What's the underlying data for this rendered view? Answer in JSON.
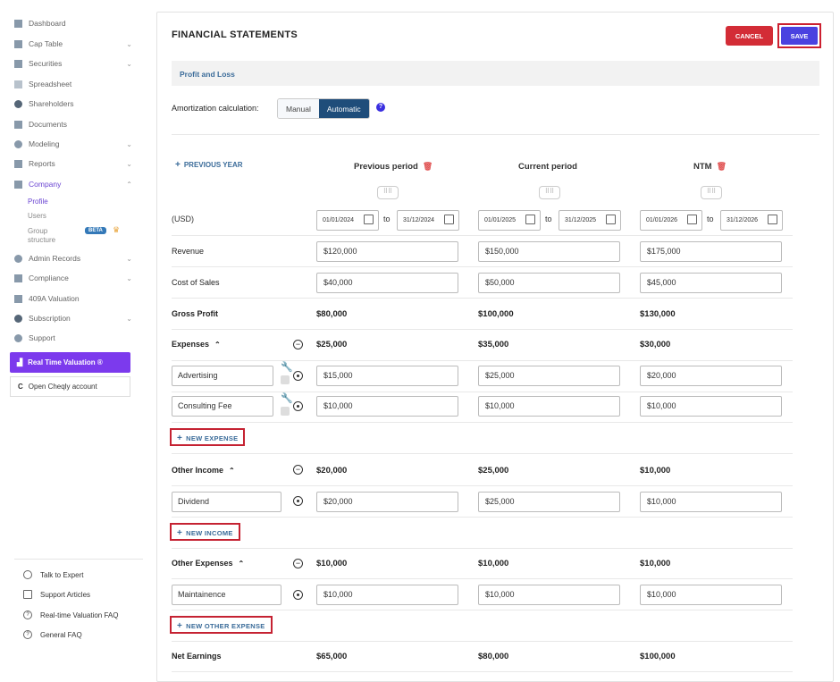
{
  "sidebar": {
    "items": [
      {
        "label": "Dashboard",
        "icon": "dashboard-icon"
      },
      {
        "label": "Cap Table",
        "icon": "cap-table-icon"
      },
      {
        "label": "Securities",
        "icon": "securities-icon"
      },
      {
        "label": "Spreadsheet",
        "icon": "spreadsheet-icon"
      },
      {
        "label": "Shareholders",
        "icon": "shareholders-icon"
      },
      {
        "label": "Documents",
        "icon": "documents-icon"
      },
      {
        "label": "Modeling",
        "icon": "modeling-icon"
      },
      {
        "label": "Reports",
        "icon": "reports-icon"
      },
      {
        "label": "Company",
        "icon": "company-icon"
      },
      {
        "label": "Admin Records",
        "icon": "admin-records-icon"
      },
      {
        "label": "Compliance",
        "icon": "compliance-icon"
      },
      {
        "label": "409A Valuation",
        "icon": "valuation-icon"
      },
      {
        "label": "Subscription",
        "icon": "subscription-icon"
      },
      {
        "label": "Support",
        "icon": "support-icon"
      }
    ],
    "company_sub": [
      "Profile",
      "Users",
      "Group",
      "structure"
    ],
    "beta_badge": "BETA",
    "rtv_label": "Real Time Valuation ®",
    "cheqly_label": "Open Cheqly account",
    "bottom": [
      "Talk to Expert",
      "Support Articles",
      "Real-time Valuation FAQ",
      "General FAQ"
    ]
  },
  "main": {
    "title": "FINANCIAL STATEMENTS",
    "cancel": "CANCEL",
    "save": "SAVE",
    "section": "Profit and Loss",
    "amort_label": "Amortization calculation:",
    "toggle_manual": "Manual",
    "toggle_auto": "Automatic",
    "prev_year": "PREVIOUS YEAR",
    "columns": [
      "Previous period",
      "Current period",
      "NTM"
    ],
    "usd": "(USD)",
    "to": "to",
    "dates": [
      [
        "01/01/2024",
        "31/12/2024"
      ],
      [
        "01/01/2025",
        "31/12/2025"
      ],
      [
        "01/01/2026",
        "31/12/2026"
      ]
    ],
    "revenue": {
      "label": "Revenue",
      "values": [
        "$120,000",
        "$150,000",
        "$175,000"
      ]
    },
    "cos": {
      "label": "Cost of Sales",
      "values": [
        "$40,000",
        "$50,000",
        "$45,000"
      ]
    },
    "gross": {
      "label": "Gross Profit",
      "values": [
        "$80,000",
        "$100,000",
        "$130,000"
      ]
    },
    "expenses": {
      "label": "Expenses",
      "values": [
        "$25,000",
        "$35,000",
        "$30,000"
      ]
    },
    "advertising": {
      "label": "Advertising",
      "values": [
        "$15,000",
        "$25,000",
        "$20,000"
      ]
    },
    "consulting": {
      "label": "Consulting Fee",
      "values": [
        "$10,000",
        "$10,000",
        "$10,000"
      ]
    },
    "new_expense": "NEW EXPENSE",
    "other_income": {
      "label": "Other Income",
      "values": [
        "$20,000",
        "$25,000",
        "$10,000"
      ]
    },
    "dividend": {
      "label": "Dividend",
      "values": [
        "$20,000",
        "$25,000",
        "$10,000"
      ]
    },
    "new_income": "NEW INCOME",
    "other_expenses": {
      "label": "Other Expenses",
      "values": [
        "$10,000",
        "$10,000",
        "$10,000"
      ]
    },
    "maintainence": {
      "label": "Maintainence",
      "values": [
        "$10,000",
        "$10,000",
        "$10,000"
      ]
    },
    "new_other": "NEW OTHER EXPENSE",
    "net": {
      "label": "Net Earnings",
      "values": [
        "$65,000",
        "$80,000",
        "$100,000"
      ]
    }
  }
}
